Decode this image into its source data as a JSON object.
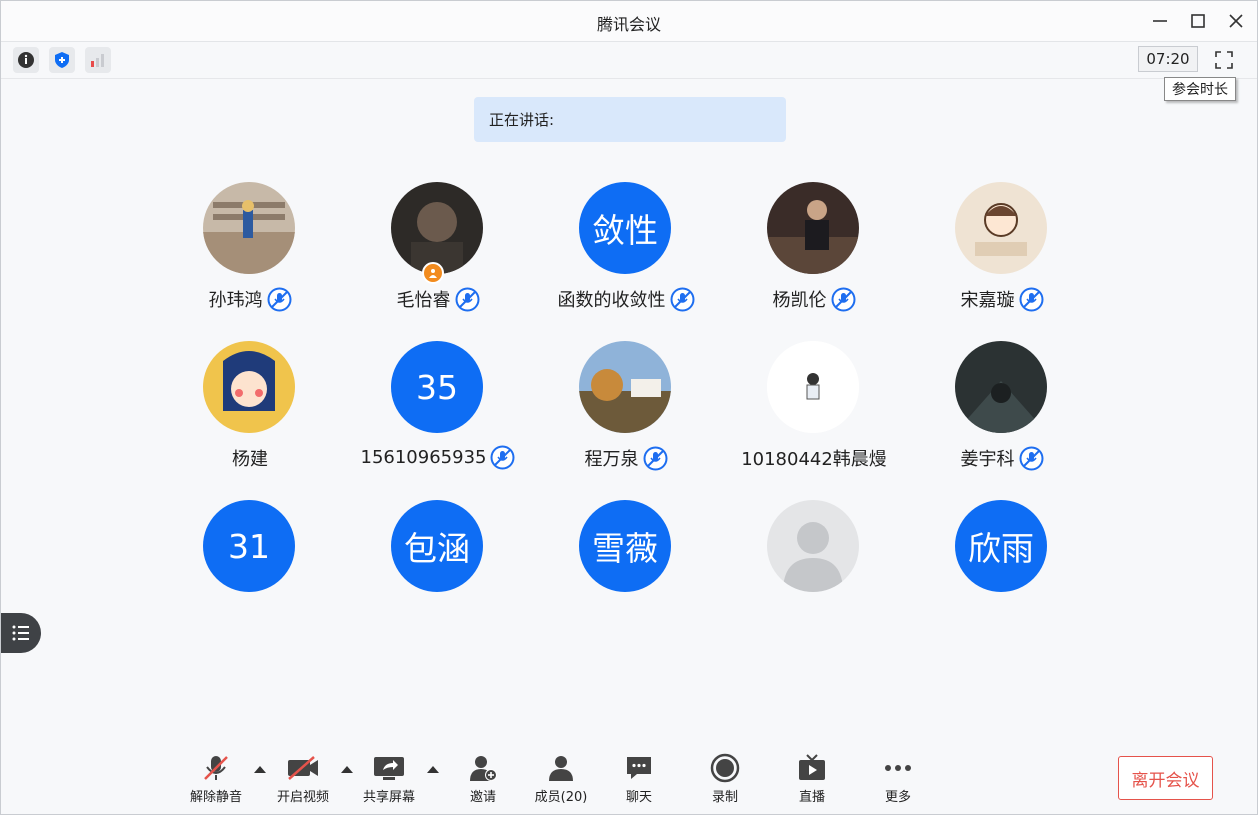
{
  "window": {
    "title": "腾讯会议"
  },
  "toolbar": {
    "timer": "07:20",
    "tooltip": "参会时长",
    "icons": [
      "info-icon",
      "shield-icon",
      "signal-icon",
      "fullscreen-icon"
    ]
  },
  "speaking": {
    "label": "正在讲话:"
  },
  "participants": [
    {
      "name": "孙玮鸿",
      "avatar_type": "photo",
      "mic": true
    },
    {
      "name": "毛怡睿",
      "avatar_type": "photo",
      "mic": true,
      "host": true
    },
    {
      "name": "函数的收敛性",
      "avatar_type": "text",
      "avatar_text": "敛性",
      "mic": true
    },
    {
      "name": "杨凯伦",
      "avatar_type": "photo",
      "mic": true
    },
    {
      "name": "宋嘉璇",
      "avatar_type": "photo",
      "mic": true
    },
    {
      "name": "杨建",
      "avatar_type": "photo",
      "mic": false
    },
    {
      "name": "15610965935",
      "avatar_type": "text",
      "avatar_text": "35",
      "mic": true
    },
    {
      "name": "程万泉",
      "avatar_type": "photo",
      "mic": true
    },
    {
      "name": "10180442韩晨熳",
      "avatar_type": "photo",
      "mic": false
    },
    {
      "name": "姜宇科",
      "avatar_type": "photo",
      "mic": true
    },
    {
      "name": "",
      "avatar_type": "text",
      "avatar_text": "31",
      "mic": false
    },
    {
      "name": "",
      "avatar_type": "text",
      "avatar_text": "包涵",
      "mic": false
    },
    {
      "name": "",
      "avatar_type": "text",
      "avatar_text": "雪薇",
      "mic": false
    },
    {
      "name": "",
      "avatar_type": "placeholder",
      "mic": false
    },
    {
      "name": "",
      "avatar_type": "text",
      "avatar_text": "欣雨",
      "mic": false
    }
  ],
  "controls": {
    "unmute": "解除静音",
    "start_video": "开启视频",
    "share_screen": "共享屏幕",
    "invite": "邀请",
    "members": "成员(20)",
    "chat": "聊天",
    "record": "录制",
    "live": "直播",
    "more": "更多",
    "leave": "离开会议"
  },
  "colors": {
    "accent": "#0e6df4",
    "danger": "#e5534b",
    "speaking_bg": "#d9e8fb"
  }
}
